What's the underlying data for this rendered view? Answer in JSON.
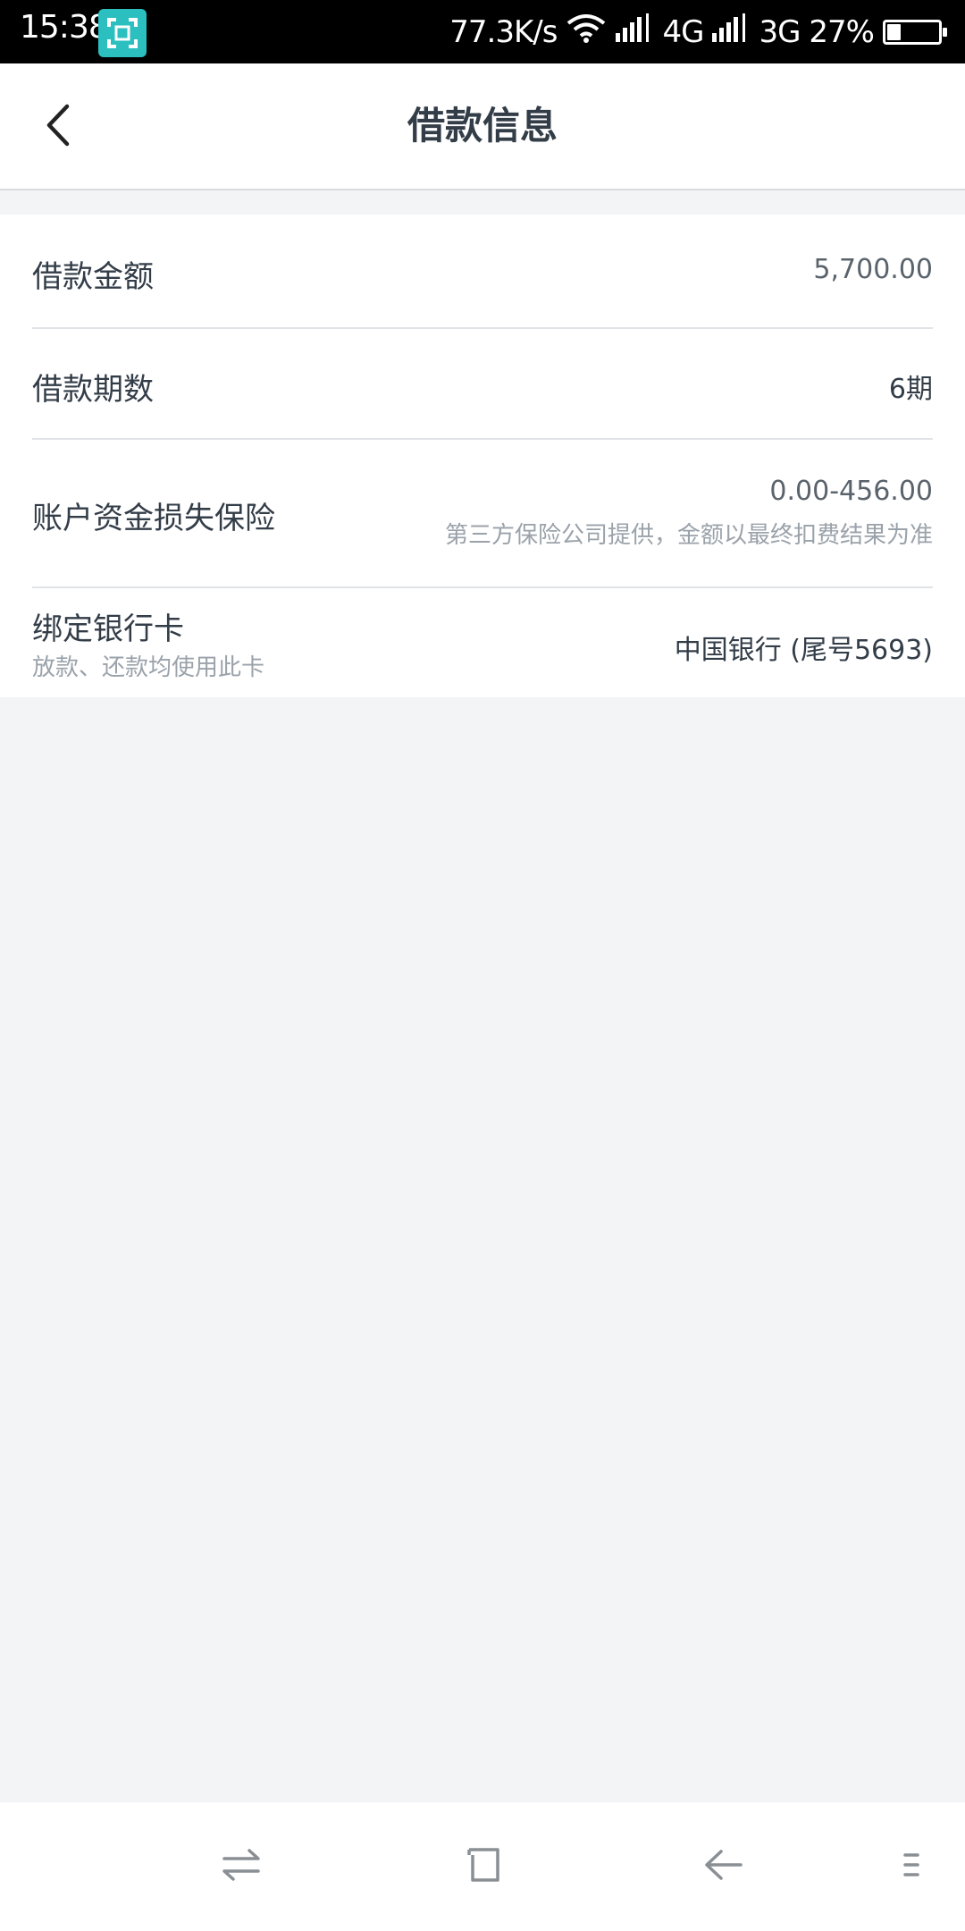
{
  "status_bar": {
    "time": "15:38",
    "network_speed": "77.3K/s",
    "network_1": "4G",
    "network_2": "3G",
    "battery_percent": "27%",
    "battery_level": 0.27,
    "icons": [
      "screenshot-icon",
      "wifi-icon",
      "signal-icon",
      "battery-icon"
    ]
  },
  "header": {
    "title": "借款信息",
    "back_icon": "chevron-left-icon"
  },
  "loan_info": {
    "amount": {
      "label": "借款金额",
      "value": "5,700.00"
    },
    "periods": {
      "label": "借款期数",
      "value": "6期"
    },
    "insurance": {
      "label": "账户资金损失保险",
      "value": "0.00-456.00",
      "note": "第三方保险公司提供，金额以最终扣费结果为准"
    },
    "bank_card": {
      "label": "绑定银行卡",
      "sublabel": "放款、还款均使用此卡",
      "value": "中国银行 (尾号5693)"
    }
  },
  "nav_bar": {
    "icons": [
      "switch-icon",
      "home-icon",
      "back-arrow-icon",
      "menu-icon"
    ]
  },
  "colors": {
    "background": "#f2f4f6",
    "text_primary": "#333d48",
    "text_secondary": "#9aa2aa",
    "accent": "#2bbfc0"
  }
}
